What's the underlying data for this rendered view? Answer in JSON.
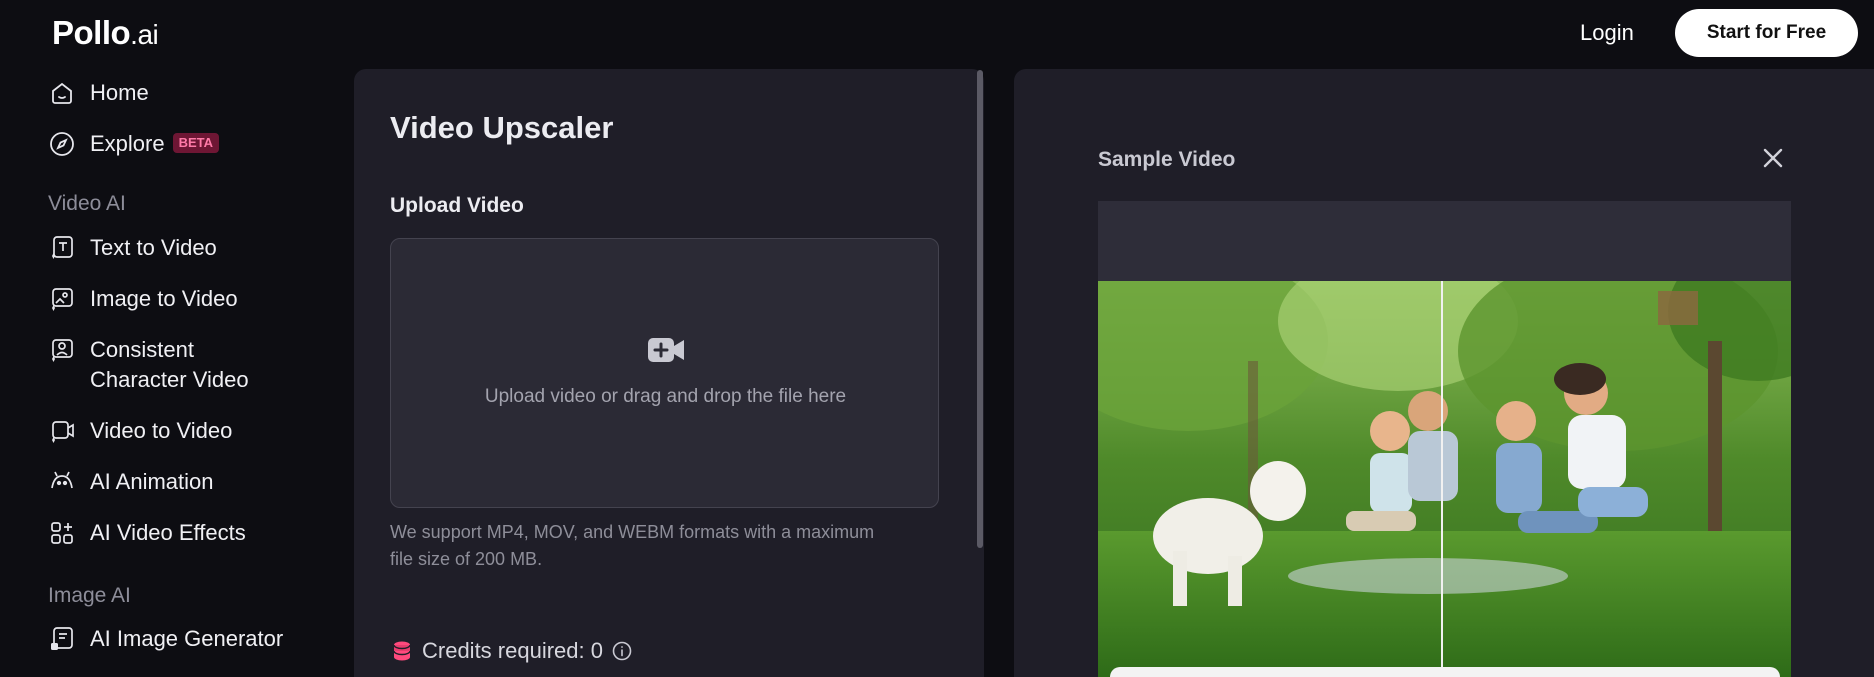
{
  "header": {
    "logo_main": "Pollo",
    "logo_suffix": ".ai",
    "login_label": "Login",
    "start_label": "Start for Free"
  },
  "sidebar": {
    "home": "Home",
    "explore": "Explore",
    "explore_badge": "BETA",
    "section_video": "Video AI",
    "text_to_video": "Text to Video",
    "image_to_video": "Image to Video",
    "consistent_line1": "Consistent",
    "consistent_line2": "Character Video",
    "video_to_video": "Video to Video",
    "ai_animation": "AI Animation",
    "ai_video_effects": "AI Video Effects",
    "section_image": "Image AI",
    "ai_image_generator": "AI Image Generator"
  },
  "editor": {
    "title": "Video Upscaler",
    "upload_label": "Upload Video",
    "dropzone_text": "Upload video or drag and drop the file here",
    "support_text": "We support MP4, MOV, and WEBM formats with a maximum file size of 200 MB.",
    "credits_text": "Credits required: 0"
  },
  "preview": {
    "title": "Sample Video"
  },
  "colors": {
    "background": "#0d0d12",
    "panel": "#1f1e28",
    "accent": "#ff4a7d",
    "badge_bg": "#6e1634"
  }
}
